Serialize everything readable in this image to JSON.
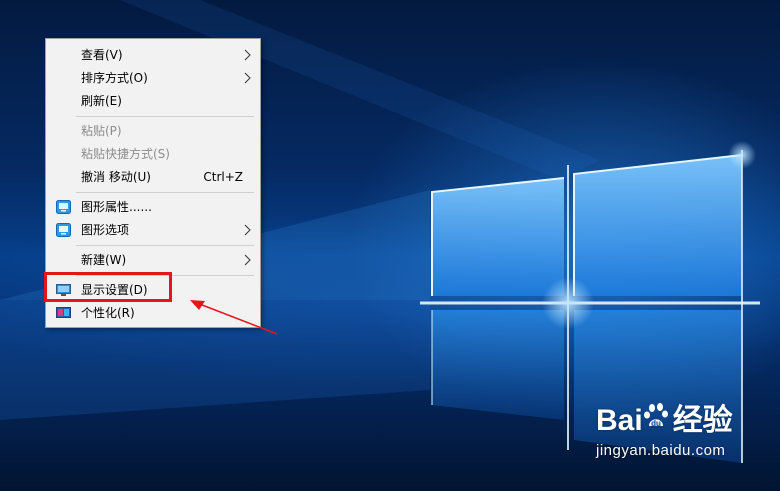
{
  "menu": {
    "items": [
      {
        "label": "查看(V)",
        "submenu": true
      },
      {
        "label": "排序方式(O)",
        "submenu": true
      },
      {
        "label": "刷新(E)"
      },
      {
        "label": "粘贴(P)",
        "disabled": true
      },
      {
        "label": "粘贴快捷方式(S)",
        "disabled": true
      },
      {
        "label": "撤消 移动(U)",
        "shortcut": "Ctrl+Z"
      },
      {
        "label": "图形属性......",
        "icon": "intel-graphics-icon"
      },
      {
        "label": "图形选项",
        "icon": "intel-graphics-icon",
        "submenu": true
      },
      {
        "label": "新建(W)",
        "submenu": true
      },
      {
        "label": "显示设置(D)",
        "icon": "display-monitor-icon",
        "highlighted": true
      },
      {
        "label": "个性化(R)",
        "icon": "personalize-icon"
      }
    ]
  },
  "annotation": {
    "color": "#e8141c"
  },
  "watermark": {
    "brand": "Bai",
    "brand_cn": "经验",
    "url": "jingyan.baidu.com"
  }
}
